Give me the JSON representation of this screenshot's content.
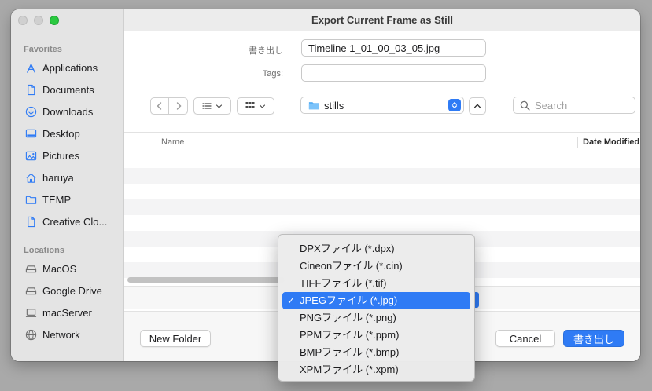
{
  "window": {
    "title": "Export Current Frame as Still"
  },
  "sidebar": {
    "favorites_heading": "Favorites",
    "favorites": [
      {
        "label": "Applications",
        "icon": "applications-icon"
      },
      {
        "label": "Documents",
        "icon": "document-icon"
      },
      {
        "label": "Downloads",
        "icon": "download-icon"
      },
      {
        "label": "Desktop",
        "icon": "desktop-icon"
      },
      {
        "label": "Pictures",
        "icon": "pictures-icon"
      },
      {
        "label": "haruya",
        "icon": "home-icon"
      },
      {
        "label": "TEMP",
        "icon": "folder-icon"
      },
      {
        "label": "Creative Clo...",
        "icon": "document-icon"
      }
    ],
    "locations_heading": "Locations",
    "locations": [
      {
        "label": "MacOS",
        "icon": "drive-icon"
      },
      {
        "label": "Google Drive",
        "icon": "drive-icon"
      },
      {
        "label": "macServer",
        "icon": "computer-icon"
      },
      {
        "label": "Network",
        "icon": "network-icon"
      }
    ]
  },
  "form": {
    "save_as_label": "書き出し",
    "save_as_value": "Timeline 1_01_00_03_05.jpg",
    "tags_label": "Tags:",
    "tags_value": ""
  },
  "toolbar": {
    "location": "stills",
    "search_placeholder": "Search"
  },
  "file_list": {
    "columns": [
      "Name",
      "Date Modified"
    ]
  },
  "format_menu": {
    "options": [
      "DPXファイル (*.dpx)",
      "Cineonファイル (*.cin)",
      "TIFFファイル (*.tif)",
      "JPEGファイル (*.jpg)",
      "PNGファイル (*.png)",
      "PPMファイル (*.ppm)",
      "BMPファイル (*.bmp)",
      "XPMファイル (*.xpm)"
    ],
    "selected_index": 3,
    "check_mark": "✓"
  },
  "buttons": {
    "new_folder": "New Folder",
    "cancel": "Cancel",
    "export": "書き出し"
  },
  "colors": {
    "accent": "#2f7bf5",
    "sidebar_icon": "#2f7bf5"
  }
}
